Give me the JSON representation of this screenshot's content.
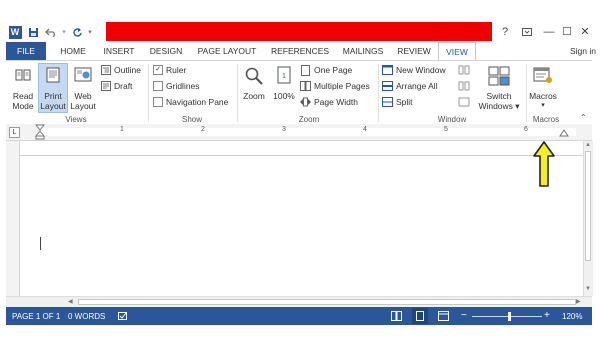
{
  "qat": {
    "save_icon": "save-icon",
    "undo_icon": "undo-icon",
    "redo_icon": "redo-icon",
    "word_letter": "W"
  },
  "window": {
    "help": "?",
    "minimize": "—",
    "restore": "☐",
    "close": "✕"
  },
  "tabs": [
    {
      "label": "FILE"
    },
    {
      "label": "HOME"
    },
    {
      "label": "INSERT"
    },
    {
      "label": "DESIGN"
    },
    {
      "label": "PAGE LAYOUT"
    },
    {
      "label": "REFERENCES"
    },
    {
      "label": "MAILINGS"
    },
    {
      "label": "REVIEW"
    },
    {
      "label": "VIEW"
    }
  ],
  "signin": "Sign in",
  "ribbon": {
    "views": {
      "label": "Views",
      "read_mode": "Read Mode",
      "read_mode_1": "Read",
      "read_mode_2": "Mode",
      "print_layout_1": "Print",
      "print_layout_2": "Layout",
      "web_layout_1": "Web",
      "web_layout_2": "Layout",
      "outline": "Outline",
      "draft": "Draft"
    },
    "show": {
      "label": "Show",
      "ruler": "Ruler",
      "gridlines": "Gridlines",
      "navigation_pane": "Navigation Pane"
    },
    "zoom": {
      "label": "Zoom",
      "zoom": "Zoom",
      "hundred": "100%",
      "one_page": "One Page",
      "multiple_pages": "Multiple Pages",
      "page_width": "Page Width"
    },
    "window": {
      "label": "Window",
      "new_window": "New Window",
      "arrange_all": "Arrange All",
      "split": "Split",
      "switch_1": "Switch",
      "switch_2": "Windows ▾"
    },
    "macros": {
      "label": "Macros",
      "macros": "Macros"
    }
  },
  "ruler": {
    "numbers": [
      "1",
      "1",
      "2",
      "3",
      "4",
      "5",
      "6"
    ],
    "corner": "L"
  },
  "statusbar": {
    "page": "PAGE 1 OF 1",
    "words": "0 WORDS",
    "zoom": "120%"
  },
  "colors": {
    "accent": "#2b579a",
    "highlight_bar": "#ee0000",
    "arrow": "#f5ef1e"
  }
}
